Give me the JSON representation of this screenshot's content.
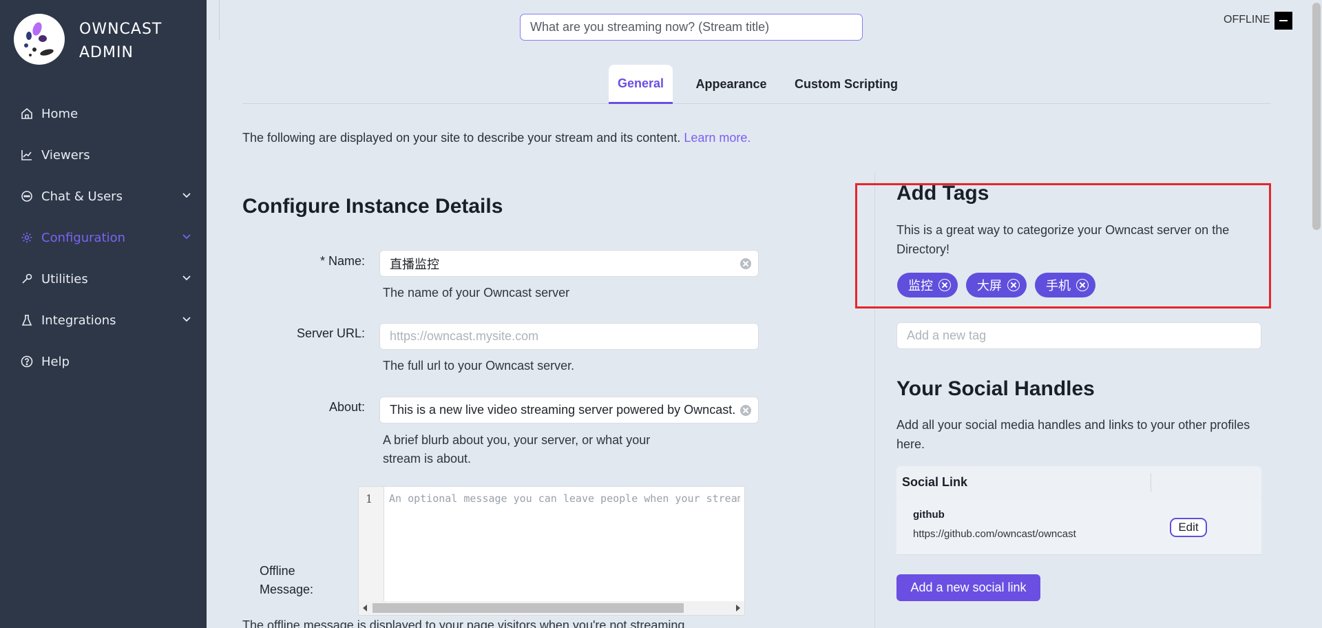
{
  "sidebar": {
    "brand_line1": "OWNCAST",
    "brand_line2": "ADMIN",
    "items": [
      {
        "label": "Home",
        "icon": "home-icon",
        "expandable": false,
        "active": false
      },
      {
        "label": "Viewers",
        "icon": "line-chart-icon",
        "expandable": false,
        "active": false
      },
      {
        "label": "Chat & Users",
        "icon": "chat-icon",
        "expandable": true,
        "active": false
      },
      {
        "label": "Configuration",
        "icon": "gear-icon",
        "expandable": true,
        "active": true
      },
      {
        "label": "Utilities",
        "icon": "tool-icon",
        "expandable": true,
        "active": false
      },
      {
        "label": "Integrations",
        "icon": "flask-icon",
        "expandable": true,
        "active": false
      },
      {
        "label": "Help",
        "icon": "question-circle-icon",
        "expandable": false,
        "active": false
      }
    ]
  },
  "header": {
    "stream_title_placeholder": "What are you streaming now? (Stream title)",
    "status": "OFFLINE"
  },
  "tabs": [
    "General",
    "Appearance",
    "Custom Scripting"
  ],
  "intro": {
    "text": "The following are displayed on your site to describe your stream and its content.",
    "link": "Learn more."
  },
  "instance": {
    "heading": "Configure Instance Details",
    "name_label": "* Name:",
    "name_value": "直播监控",
    "name_help": "The name of your Owncast server",
    "url_label": "Server URL:",
    "url_placeholder": "https://owncast.mysite.com",
    "url_help": "The full url to your Owncast server.",
    "about_label": "About:",
    "about_value": "This is a new live video streaming server powered by Owncast.",
    "about_help_line1": "A brief blurb about you, your server, or what your",
    "about_help_line2": "stream is about.",
    "offline_label_line1": "Offline",
    "offline_label_line2": "Message:",
    "offline_line_number": "1",
    "offline_placeholder": "An optional message you can leave people when your stream is not live.",
    "offline_help": "The offline message is displayed to your page visitors when you're not streaming."
  },
  "tags": {
    "heading": "Add Tags",
    "description": "This is a great way to categorize your Owncast server on the Directory!",
    "items": [
      "监控",
      "大屏",
      "手机"
    ],
    "input_placeholder": "Add a new tag"
  },
  "social": {
    "heading": "Your Social Handles",
    "description": "Add all your social media handles and links to your other profiles here.",
    "column_header": "Social Link",
    "rows": [
      {
        "platform": "github",
        "url": "https://github.com/owncast/owncast",
        "action": "Edit"
      }
    ],
    "add_button": "Add a new social link"
  },
  "colors": {
    "sidebar_bg": "#2d3748",
    "accent": "#6a4fe2",
    "highlight": "#e6262a",
    "page_bg": "#e2e8f0"
  }
}
